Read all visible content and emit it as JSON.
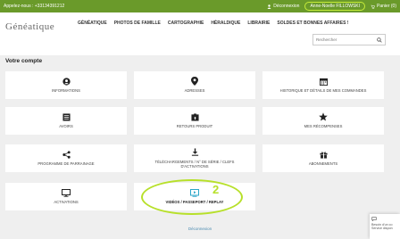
{
  "topbar": {
    "phone": "Appelez-nous : +33134391212",
    "logout": "Déconnexion",
    "account": "Anne-Noelle FILLOWSKI",
    "cart": "Panier (0)"
  },
  "logo": "Généatique",
  "nav": [
    "GÉNÉATIQUE",
    "PHOTOS DE FAMILLE",
    "CARTOGRAPHIE",
    "HÉRALDIQUE",
    "LIBRAIRIE",
    "SOLDES ET BONNES AFFAIRES !"
  ],
  "search": {
    "placeholder": "Rechercher"
  },
  "page_title": "Votre compte",
  "tiles": [
    {
      "label": "INFORMATIONS",
      "icon": "user-circle-icon"
    },
    {
      "label": "ADRESSES",
      "icon": "map-pin-icon"
    },
    {
      "label": "HISTORIQUE ET DÉTAILS DE MES COMMANDES",
      "icon": "calendar-icon"
    },
    {
      "label": "AVOIRS",
      "icon": "document-list-icon"
    },
    {
      "label": "RETOURS PRODUIT",
      "icon": "return-box-icon"
    },
    {
      "label": "MES RÉCOMPENSES",
      "icon": "star-icon"
    },
    {
      "label": "PROGRAMME DE PARRAINAGE",
      "icon": "share-icon"
    },
    {
      "label": "TÉLÉCHARGEMENTS / N° DE SÉRIE / CLEFS D'ACTIVATIONS",
      "icon": "download-icon"
    },
    {
      "label": "ABONNEMENTS",
      "icon": "gift-box-icon"
    },
    {
      "label": "ACTIVATIONS",
      "icon": "monitor-icon"
    },
    {
      "label": "VIDÉOS / PASSEPORT / REPLAY",
      "icon": "play-video-icon"
    }
  ],
  "logout_link": "Déconnexion",
  "chat": {
    "line1": "Besoin d'un co",
    "line2": "Service dispon"
  },
  "annotations": {
    "step1": "1",
    "step2": "2"
  },
  "colors": {
    "topbar": "#6a9a2a",
    "annotation": "#b7e02a",
    "link": "#4a8ab0",
    "video_icon": "#2aa6c8"
  }
}
